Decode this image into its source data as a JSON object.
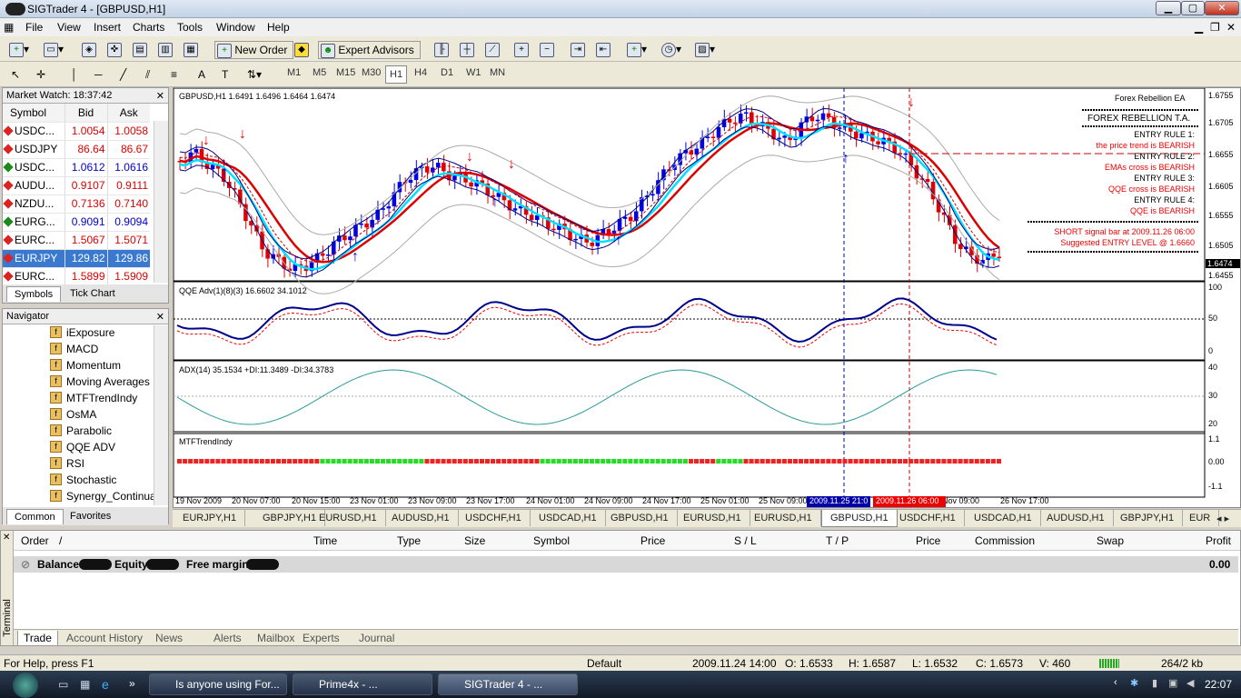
{
  "window": {
    "title": "SIGTrader 4 - [GBPUSD,H1]"
  },
  "menu": [
    "File",
    "View",
    "Insert",
    "Charts",
    "Tools",
    "Window",
    "Help"
  ],
  "toolbar": {
    "new_order": "New Order",
    "expert_advisors": "Expert Advisors"
  },
  "timeframes": [
    "M1",
    "M5",
    "M15",
    "M30",
    "H1",
    "H4",
    "D1",
    "W1",
    "MN"
  ],
  "market_watch": {
    "title": "Market Watch: 18:37:42",
    "cols": [
      "Symbol",
      "Bid",
      "Ask"
    ],
    "rows": [
      {
        "s": "USDC...",
        "b": "1.0054",
        "a": "1.0058",
        "dir": "down"
      },
      {
        "s": "USDJPY",
        "b": "86.64",
        "a": "86.67",
        "dir": "down"
      },
      {
        "s": "USDC...",
        "b": "1.0612",
        "a": "1.0616",
        "dir": "up"
      },
      {
        "s": "AUDU...",
        "b": "0.9107",
        "a": "0.9111",
        "dir": "down"
      },
      {
        "s": "NZDU...",
        "b": "0.7136",
        "a": "0.7140",
        "dir": "down"
      },
      {
        "s": "EURG...",
        "b": "0.9091",
        "a": "0.9094",
        "dir": "up"
      },
      {
        "s": "EURC...",
        "b": "1.5067",
        "a": "1.5071",
        "dir": "down"
      },
      {
        "s": "EURJPY",
        "b": "129.82",
        "a": "129.86",
        "dir": "down"
      },
      {
        "s": "EURC...",
        "b": "1.5899",
        "a": "1.5909",
        "dir": "down"
      }
    ],
    "tabs": [
      "Symbols",
      "Tick Chart"
    ]
  },
  "navigator": {
    "title": "Navigator",
    "items": [
      "iExposure",
      "MACD",
      "Momentum",
      "Moving Averages",
      "MTFTrendIndy",
      "OsMA",
      "Parabolic",
      "QQE ADV",
      "RSI",
      "Stochastic",
      "Synergy_Continua"
    ],
    "tabs": [
      "Common",
      "Favorites"
    ]
  },
  "chart": {
    "header": "GBPUSD,H1  1.6491 1.6496 1.6464 1.6474",
    "current_price": "1.6474",
    "price_ticks": [
      "1.6755",
      "1.6705",
      "1.6655",
      "1.6605",
      "1.6555",
      "1.6505",
      "1.6455"
    ],
    "ea_title": "Forex Rebellion EA",
    "ea_box": "FOREX REBELLION T.A.",
    "rules": [
      {
        "h": "ENTRY RULE 1:",
        "v": "the price trend is BEARISH"
      },
      {
        "h": "ENTRY RULE 2:",
        "v": "EMAs cross is BEARISH"
      },
      {
        "h": "ENTRY RULE 3:",
        "v": "QQE cross is BEARISH"
      },
      {
        "h": "ENTRY RULE 4:",
        "v": "QQE is BEARISH"
      }
    ],
    "signal1": "SHORT signal bar at 2009.11.26 06:00",
    "signal2": "Suggested ENTRY LEVEL @ 1.6660",
    "qqe_label": "QQE Adv(1)(8)(3) 16.6602 34.1012",
    "qqe_ticks": [
      "100",
      "50",
      "0"
    ],
    "adx_label": "ADX(14) 35.1534 +DI:11.3489 -DI:34.3783",
    "adx_ticks": [
      "40",
      "30",
      "20"
    ],
    "mtf_label": "MTFTrendIndy",
    "mtf_ticks": [
      "1.1",
      "0.00",
      "-1.1"
    ],
    "time_ticks": [
      "19 Nov 2009",
      "20 Nov 07:00",
      "20 Nov 15:00",
      "23 Nov 01:00",
      "23 Nov 09:00",
      "23 Nov 17:00",
      "24 Nov 01:00",
      "24 Nov 09:00",
      "24 Nov 17:00",
      "25 Nov 01:00",
      "25 Nov 09:00",
      "Nov 09:00",
      "26 Nov 17:00"
    ],
    "cursor_time_1": "2009.11.25 21:0",
    "cursor_time_2": "2009.11.26 06:00"
  },
  "chart_tabs": [
    "EURJPY,H1",
    "GBPJPY,H1",
    "EURUSD,H1",
    "AUDUSD,H1",
    "USDCHF,H1",
    "USDCAD,H1",
    "GBPUSD,H1",
    "EURUSD,H1",
    "EURUSD,H1",
    "GBPUSD,H1",
    "USDCHF,H1",
    "USDCAD,H1",
    "AUDUSD,H1",
    "GBPJPY,H1",
    "EUR"
  ],
  "terminal": {
    "cols": [
      "Order",
      "/",
      "Time",
      "Type",
      "Size",
      "Symbol",
      "Price",
      "S / L",
      "T / P",
      "Price",
      "Commission",
      "Swap",
      "Profit"
    ],
    "balance": "Balance:",
    "equity": "Equity:",
    "free_margin": "Free margin:",
    "profit": "0.00",
    "side": "Terminal",
    "tabs": [
      "Trade",
      "Account History",
      "News",
      "Alerts",
      "Mailbox",
      "Experts",
      "Journal"
    ]
  },
  "status": {
    "help": "For Help, press F1",
    "profile": "Default",
    "time": "2009.11.24 14:00",
    "o": "O: 1.6533",
    "h": "H: 1.6587",
    "l": "L: 1.6532",
    "c": "C: 1.6573",
    "v": "V: 460",
    "kb": "264/2 kb"
  },
  "taskbar": {
    "items": [
      "Is anyone using For...",
      "Prime4x - ...",
      "SIGTrader 4 - ..."
    ],
    "clock": "22:07"
  },
  "colors": {
    "bull": "#0000e0",
    "bear": "#e00000",
    "ema_fast": "#00e0ff",
    "ema_slow": "#dd0000"
  }
}
